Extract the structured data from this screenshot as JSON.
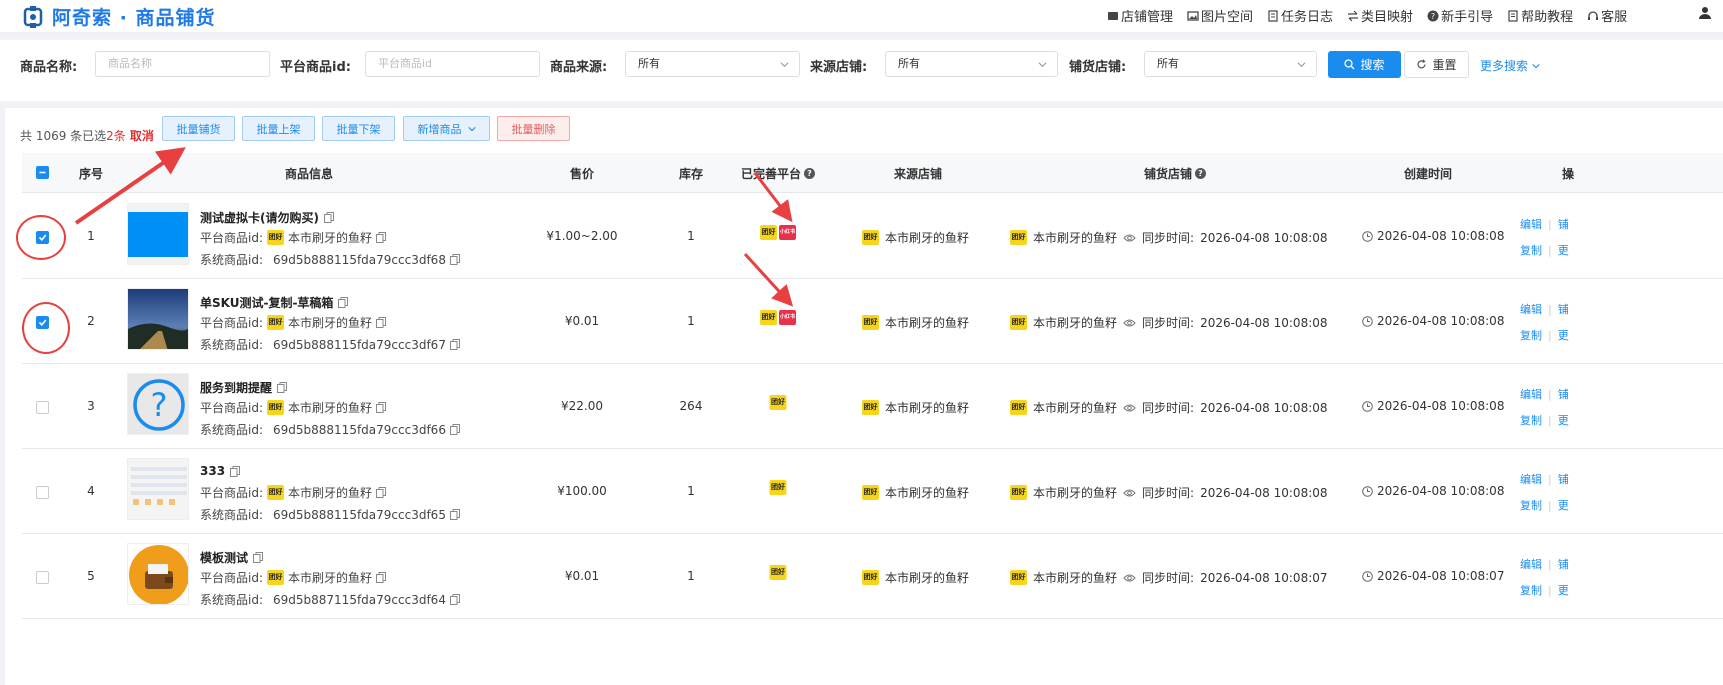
{
  "header": {
    "title": "阿奇索 · 商品铺货",
    "nav": [
      {
        "icon": "store-icon",
        "label": "店铺管理"
      },
      {
        "icon": "image-icon",
        "label": "图片空间"
      },
      {
        "icon": "log-icon",
        "label": "任务日志"
      },
      {
        "icon": "mapping-icon",
        "label": "类目映射"
      },
      {
        "icon": "help-circle-icon",
        "label": "新手引导"
      },
      {
        "icon": "book-icon",
        "label": "帮助教程"
      },
      {
        "icon": "headset-icon",
        "label": "客服"
      }
    ]
  },
  "filters": {
    "name_label": "商品名称:",
    "name_placeholder": "商品名称",
    "platform_id_label": "平台商品id:",
    "platform_id_placeholder": "平台商品id",
    "source_label": "商品来源:",
    "source_value": "所有",
    "source_store_label": "来源店铺:",
    "source_store_value": "所有",
    "dist_store_label": "铺货店铺:",
    "dist_store_value": "所有",
    "search_label": "搜索",
    "reset_label": "重置",
    "more_label": "更多搜索"
  },
  "toolbar": {
    "total_prefix": "共 1069 条已选 ",
    "selected": "2条",
    "cancel": "取消",
    "batch_distribute": "批量铺货",
    "batch_list": "批量上架",
    "batch_delist": "批量下架",
    "add_product": "新增商品",
    "batch_delete": "批量删除"
  },
  "table": {
    "columns": {
      "index": "序号",
      "info": "商品信息",
      "price": "售价",
      "stock": "库存",
      "platforms": "已完善平台",
      "source_store": "来源店铺",
      "dist_store": "铺货店铺",
      "created": "创建时间",
      "ops": "操"
    },
    "labels": {
      "platform_id": "平台商品id:",
      "system_id": "系统商品id:",
      "sync_time": "同步时间:",
      "edit": "编辑",
      "copy": "复制",
      "more1": "铺",
      "more2": "更",
      "platform_badge": "团好",
      "platform_badge_red": "小红书"
    },
    "rows": [
      {
        "index": "1",
        "name": "测试虚拟卡(请勿购买)",
        "store": "本市刷牙的鱼籽",
        "sys_id": "69d5b888115fda79ccc3df68",
        "price": "¥1.00~2.00",
        "stock": "1",
        "extra_platform": true,
        "source_store": "本市刷牙的鱼籽",
        "dist_store": "本市刷牙的鱼籽",
        "sync": "2026-04-08 10:08:08",
        "created": "2026-04-08 10:08:08",
        "checked": true,
        "thumb": "blue"
      },
      {
        "index": "2",
        "name": "单SKU测试-复制-草稿箱",
        "store": "本市刷牙的鱼籽",
        "sys_id": "69d5b888115fda79ccc3df67",
        "price": "¥0.01",
        "stock": "1",
        "extra_platform": true,
        "source_store": "本市刷牙的鱼籽",
        "dist_store": "本市刷牙的鱼籽",
        "sync": "2026-04-08 10:08:08",
        "created": "2026-04-08 10:08:08",
        "checked": true,
        "thumb": "night"
      },
      {
        "index": "3",
        "name": "服务到期提醒",
        "store": "本市刷牙的鱼籽",
        "sys_id": "69d5b888115fda79ccc3df66",
        "price": "¥22.00",
        "stock": "264",
        "extra_platform": false,
        "source_store": "本市刷牙的鱼籽",
        "dist_store": "本市刷牙的鱼籽",
        "sync": "2026-04-08 10:08:08",
        "created": "2026-04-08 10:08:08",
        "checked": false,
        "thumb": "question"
      },
      {
        "index": "4",
        "name": "333",
        "store": "本市刷牙的鱼籽",
        "sys_id": "69d5b888115fda79ccc3df65",
        "price": "¥100.00",
        "stock": "1",
        "extra_platform": false,
        "source_store": "本市刷牙的鱼籽",
        "dist_store": "本市刷牙的鱼籽",
        "sync": "2026-04-08 10:08:08",
        "created": "2026-04-08 10:08:08",
        "checked": false,
        "thumb": "grid"
      },
      {
        "index": "5",
        "name": "模板测试",
        "store": "本市刷牙的鱼籽",
        "sys_id": "69d5b887115fda79ccc3df64",
        "price": "¥0.01",
        "stock": "1",
        "extra_platform": false,
        "source_store": "本市刷牙的鱼籽",
        "dist_store": "本市刷牙的鱼籽",
        "sync": "2026-04-08 10:08:07",
        "created": "2026-04-08 10:08:07",
        "checked": false,
        "thumb": "wallet"
      }
    ]
  },
  "colors": {
    "primary": "#1a8cf0",
    "danger": "#e03030",
    "annotation": "#e84040",
    "platform_yellow": "#f6d51c",
    "platform_red": "#e8304b"
  }
}
